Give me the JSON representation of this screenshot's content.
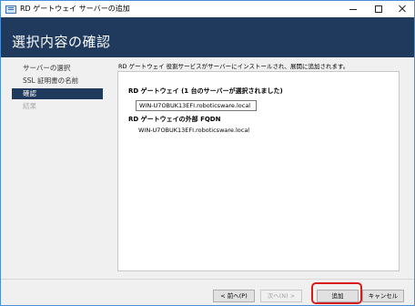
{
  "window": {
    "title": "RD ゲートウェイ サーバーの追加"
  },
  "header": {
    "page_title": "選択内容の確認"
  },
  "nav": {
    "items": [
      {
        "label": "サーバーの選択",
        "state": "normal"
      },
      {
        "label": "SSL 証明書の名前",
        "state": "normal"
      },
      {
        "label": "確認",
        "state": "selected"
      },
      {
        "label": "結果",
        "state": "disabled"
      }
    ]
  },
  "main": {
    "description": "RD ゲートウェイ 役割サービスがサーバーにインストールされ、展開に追加されます。",
    "gateway_section_title": "RD ゲートウェイ (1 台のサーバーが選択されました)",
    "gateway_server": "WIN-U7OBUK13EFI.roboticsware.local",
    "fqdn_section_title": "RD ゲートウェイの外部 FQDN",
    "fqdn_value": "WIN-U7OBUK13EFI.roboticsware.local"
  },
  "footer": {
    "prev_label": "< 前へ(P)",
    "next_label": "次へ(N) >",
    "add_label": "追加",
    "cancel_label": "キャンセル"
  },
  "colors": {
    "header_bg": "#1f3a5c",
    "selected_nav_bg": "#1f3a5c",
    "highlight": "#d81c1c"
  },
  "icons": {
    "app": "server-manager-icon"
  }
}
